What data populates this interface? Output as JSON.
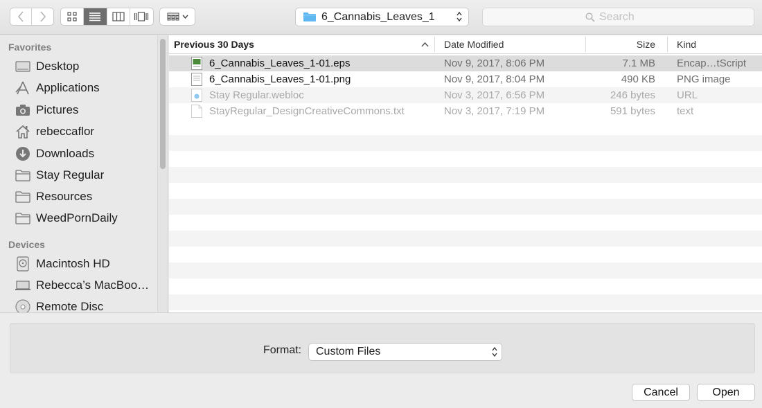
{
  "toolbar": {
    "location": "6_Cannabis_Leaves_1",
    "search_placeholder": "Search"
  },
  "sidebar": {
    "favorites_heading": "Favorites",
    "favorites": [
      {
        "label": "Desktop",
        "icon": "desktop-icon"
      },
      {
        "label": "Applications",
        "icon": "applications-icon"
      },
      {
        "label": "Pictures",
        "icon": "pictures-icon"
      },
      {
        "label": "rebeccaflor",
        "icon": "home-icon"
      },
      {
        "label": "Downloads",
        "icon": "downloads-icon"
      },
      {
        "label": "Stay Regular",
        "icon": "folder-icon"
      },
      {
        "label": "Resources",
        "icon": "folder-icon"
      },
      {
        "label": "WeedPornDaily",
        "icon": "folder-icon"
      }
    ],
    "devices_heading": "Devices",
    "devices": [
      {
        "label": "Macintosh HD",
        "icon": "hard-drive-icon"
      },
      {
        "label": "Rebecca’s MacBoo…",
        "icon": "laptop-icon"
      },
      {
        "label": "Remote Disc",
        "icon": "disc-icon"
      }
    ]
  },
  "columns": {
    "name": "Previous 30 Days",
    "date": "Date Modified",
    "size": "Size",
    "kind": "Kind"
  },
  "files": [
    {
      "name": "6_Cannabis_Leaves_1-01.eps",
      "date": "Nov 9, 2017, 8:06 PM",
      "size": "7.1 MB",
      "kind": "Encap…tScript",
      "icon": "eps-file-icon",
      "state": "selected"
    },
    {
      "name": "6_Cannabis_Leaves_1-01.png",
      "date": "Nov 9, 2017, 8:04 PM",
      "size": "490 KB",
      "kind": "PNG image",
      "icon": "png-file-icon",
      "state": "normal"
    },
    {
      "name": "Stay Regular.webloc",
      "date": "Nov 3, 2017, 6:56 PM",
      "size": "246 bytes",
      "kind": "URL",
      "icon": "webloc-file-icon",
      "state": "disabled"
    },
    {
      "name": "StayRegular_DesignCreativeCommons.txt",
      "date": "Nov 3, 2017, 7:19 PM",
      "size": "591 bytes",
      "kind": "text",
      "icon": "text-file-icon",
      "state": "disabled"
    }
  ],
  "options": {
    "format_label": "Format:",
    "format_value": "Custom Files"
  },
  "buttons": {
    "cancel": "Cancel",
    "open": "Open"
  },
  "colors": {
    "selected_row": "#dcdcdc",
    "alt_row": "#f4f4f4",
    "sidebar_bg": "#e9e9e9",
    "folder_blue": "#5fb8f0"
  }
}
